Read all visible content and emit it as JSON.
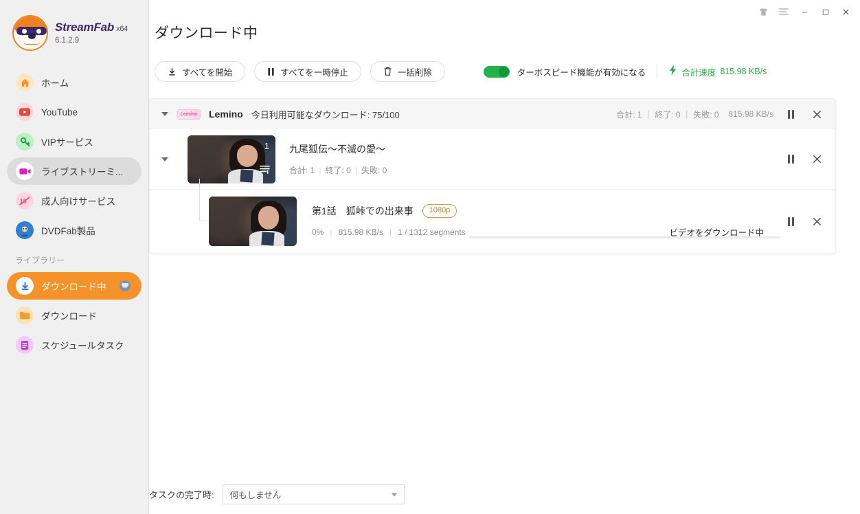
{
  "app": {
    "brand_name": "StreamFab",
    "brand_arch": "x64",
    "version": "6.1.2.9"
  },
  "titlebar": {
    "buttons": [
      {
        "name": "theme-icon",
        "label": "▼"
      },
      {
        "name": "menu-icon",
        "label": "☰"
      },
      {
        "name": "minimize-icon",
        "label": "–"
      },
      {
        "name": "maximize-icon",
        "label": "□"
      },
      {
        "name": "close-icon",
        "label": "✕"
      }
    ]
  },
  "sidebar": {
    "items": [
      {
        "label": "ホーム",
        "icon": "home-icon"
      },
      {
        "label": "YouTube",
        "icon": "youtube-icon"
      },
      {
        "label": "VIPサービス",
        "icon": "key-icon"
      },
      {
        "label": "ライブストリーミ...",
        "icon": "video-camera-icon"
      },
      {
        "label": "成人向けサービス",
        "icon": "adult-18-icon"
      },
      {
        "label": "DVDFab製品",
        "icon": "dvdfab-icon"
      }
    ],
    "group_title": "ライブラリー",
    "library_items": [
      {
        "label": "ダウンロード中",
        "icon": "download-arrow-icon"
      },
      {
        "label": "ダウンロード",
        "icon": "folder-icon"
      },
      {
        "label": "スケジュールタスク",
        "icon": "schedule-icon"
      }
    ]
  },
  "header": {
    "title": "ダウンロード中"
  },
  "toolbar": {
    "start_all": "すべてを開始",
    "pause_all": "すべてを一時停止",
    "delete_all": "一括削除",
    "turbo_label": "ターボスピード機能が有効になる",
    "turbo_on": true,
    "speed_label": "合計速度",
    "speed_value": "815.98 KB/s"
  },
  "card": {
    "site_logo_text": "Lemino",
    "site_name": "Lemino",
    "quota": "今日利用可能なダウンロード: 75/100",
    "stats": "合計: 1 ｜ 終了: 0 ｜ 失敗: 0",
    "speed": "815.98 KB/s",
    "series": {
      "title": "九尾狐伝～不滅の愛～",
      "thumb_count": "1",
      "stats_total_label": "合計: 1",
      "stats_done_label": "終了: 0",
      "stats_failed_label": "失敗: 0"
    },
    "episode": {
      "title": "第1話　狐峠での出来事",
      "quality": "1080p",
      "percent": "0%",
      "speed": "815.98 KB/s",
      "segments": "1 / 1312 segments",
      "status": "ビデオをダウンロード中",
      "progress_value": 0
    }
  },
  "footer": {
    "label": "タスクの完了時:",
    "selected": "何もしません"
  },
  "colors": {
    "accent_orange": "#f5932a",
    "green": "#2ca84a",
    "badge_gold": "#b5873a"
  }
}
